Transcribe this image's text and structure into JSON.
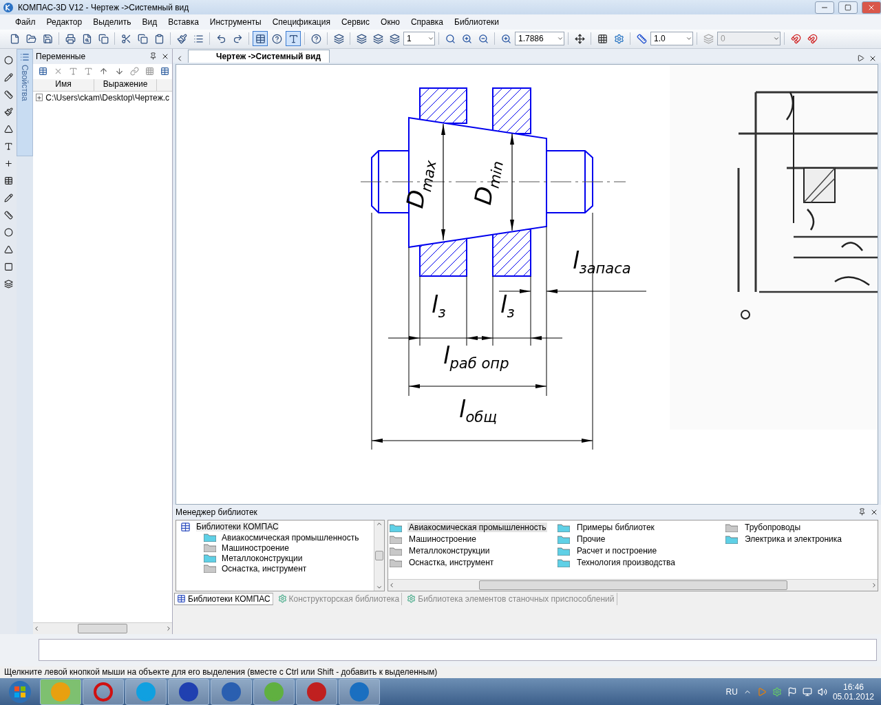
{
  "window": {
    "title": "КОМПАС-3D V12 - Чертеж ->Системный вид"
  },
  "menu": [
    "Файл",
    "Редактор",
    "Выделить",
    "Вид",
    "Вставка",
    "Инструменты",
    "Спецификация",
    "Сервис",
    "Окно",
    "Справка",
    "Библиотеки"
  ],
  "toolbar": {
    "page": "1",
    "zoom": "1.7886",
    "step": "1.0",
    "layer": "0"
  },
  "side_tab": {
    "label": "Свойства",
    "selected": true
  },
  "variables_panel": {
    "title": "Переменные",
    "columns": [
      "Имя",
      "Выражение"
    ],
    "items": [
      {
        "label": "C:\\Users\\ckam\\Desktop\\Чертеж.c",
        "expanded": false
      }
    ]
  },
  "document_tab": {
    "label": "Чертеж ->Системный вид",
    "selected": true
  },
  "drawing": {
    "labels": [
      {
        "kind": "vertical",
        "text": "D$_{max}$"
      },
      {
        "kind": "vertical",
        "text": "D$_{min}$"
      },
      {
        "kind": "horizontal",
        "text": "l$_{запаса}$"
      },
      {
        "kind": "horizontal",
        "text": "l$_{з}$"
      },
      {
        "kind": "horizontal",
        "text": "l$_{з}$"
      },
      {
        "kind": "horizontal",
        "text": "l$_{раб опр}$"
      },
      {
        "kind": "horizontal",
        "text": "l$_{общ}$"
      }
    ]
  },
  "library_manager": {
    "title": "Менеджер библиотек",
    "tree": {
      "label": "Библиотеки КОМПАС",
      "children": [
        {
          "label": "Авиакосмическая промышленность",
          "color": "#5fd0e6"
        },
        {
          "label": "Машиностроение",
          "color": "#c8c8c8"
        },
        {
          "label": "Металлоконструкции",
          "color": "#5fd0e6"
        },
        {
          "label": "Оснастка, инструмент",
          "color": "#c8c8c8"
        }
      ]
    },
    "items": [
      {
        "label": "Авиакосмическая промышленность",
        "color": "#5fd0e6",
        "selected": true
      },
      {
        "label": "Машиностроение",
        "color": "#c8c8c8",
        "selected": false
      },
      {
        "label": "Металлоконструкции",
        "color": "#c8c8c8",
        "selected": false
      },
      {
        "label": "Оснастка, инструмент",
        "color": "#c8c8c8",
        "selected": false
      },
      {
        "label": "Примеры библиотек",
        "color": "#5fd0e6",
        "selected": false
      },
      {
        "label": "Прочие",
        "color": "#5fd0e6",
        "selected": false
      },
      {
        "label": "Расчет и построение",
        "color": "#5fd0e6",
        "selected": false
      },
      {
        "label": "Технология производства",
        "color": "#5fd0e6",
        "selected": false
      },
      {
        "label": "Трубопроводы",
        "color": "#c8c8c8",
        "selected": false
      },
      {
        "label": "Электрика и электроника",
        "color": "#5fd0e6",
        "selected": false
      }
    ],
    "tabs": [
      {
        "label": "Библиотеки КОМПАС",
        "selected": true
      },
      {
        "label": "Конструкторская библиотека",
        "selected": false
      },
      {
        "label": "Библиотека элементов станочных приспособлений",
        "selected": false
      }
    ]
  },
  "status_bar": {
    "text": "Щелкните левой кнопкой мыши на объекте для его выделения (вместе с Ctrl или Shift - добавить к выделенным)"
  },
  "tray": {
    "language": "RU",
    "time": "16:46",
    "date": "05.01.2012"
  }
}
